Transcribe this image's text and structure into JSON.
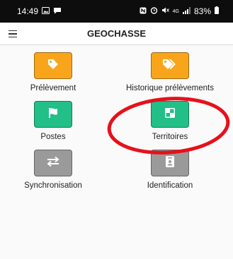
{
  "status_bar": {
    "time": "14:49",
    "left_icons": [
      "image-icon",
      "message-icon"
    ],
    "right_icons": [
      "nfc-icon",
      "alarm-icon",
      "mute-icon",
      "signal-icon",
      "battery-icon"
    ],
    "network": "4G",
    "battery": "83%"
  },
  "app_bar": {
    "title": "GEOCHASSE",
    "menu_icon": "hamburger-menu-icon"
  },
  "tiles": [
    {
      "id": "prelevement",
      "label": "Prélèvement",
      "icon": "tag-icon",
      "color": "#f9a51b"
    },
    {
      "id": "historique",
      "label": "Historique prélèvements",
      "icon": "tags-icon",
      "color": "#f9a51b"
    },
    {
      "id": "postes",
      "label": "Postes",
      "icon": "flag-icon",
      "color": "#22bf88"
    },
    {
      "id": "territoires",
      "label": "Territoires",
      "icon": "territory-map-icon",
      "color": "#22bf88"
    },
    {
      "id": "synchronisation",
      "label": "Synchronisation",
      "icon": "sync-arrows-icon",
      "color": "#9a9a9a"
    },
    {
      "id": "identification",
      "label": "Identification",
      "icon": "id-badge-icon",
      "color": "#9a9a9a"
    }
  ],
  "annotation": {
    "shape": "red-ellipse",
    "target": "Territoires",
    "color": "#e8101a"
  }
}
